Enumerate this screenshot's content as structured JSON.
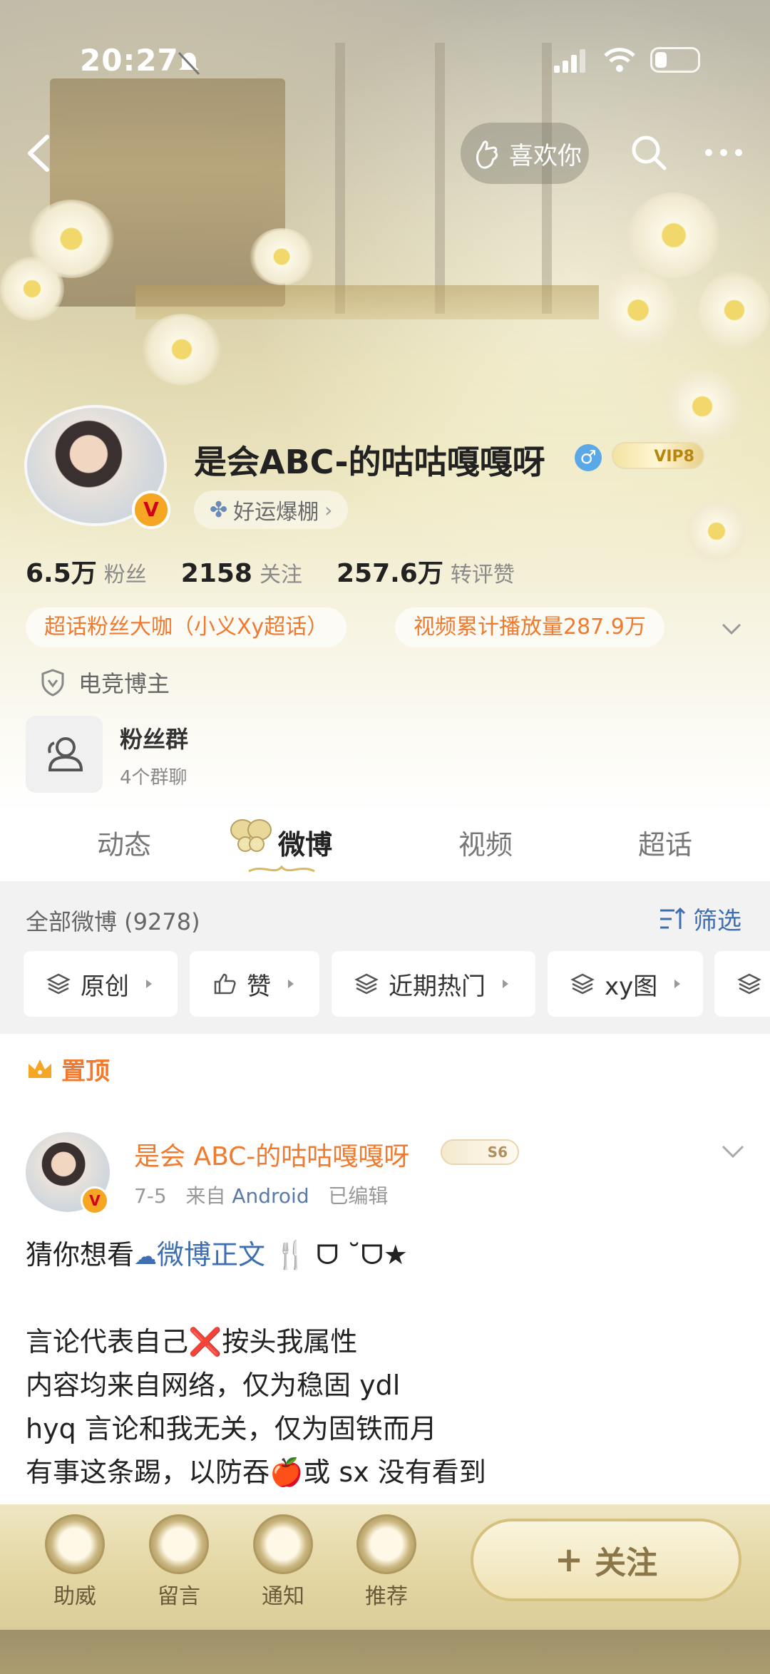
{
  "status_bar": {
    "time": "20:27"
  },
  "nav": {
    "like_label": "喜欢你"
  },
  "profile": {
    "name": "是会ABC-的咕咕嘎嘎呀",
    "vip_label": "VIP8",
    "luck_label": "好运爆棚",
    "verified_mark": "V",
    "stats": [
      {
        "num": "6.5万",
        "label": "粉丝"
      },
      {
        "num": "2158",
        "label": "关注"
      },
      {
        "num": "257.6万",
        "label": "转评赞"
      }
    ],
    "tags": [
      "超话粉丝大咖（小义Xy超话）",
      "视频累计播放量287.9万"
    ],
    "role": "电竞博主",
    "group": {
      "title": "粉丝群",
      "subtitle": "4个群聊"
    }
  },
  "tabs": [
    "动态",
    "微博",
    "视频",
    "超话"
  ],
  "feed": {
    "all_count": "全部微博 (9278)",
    "filter_label": "筛选",
    "chips": [
      "原创",
      "赞",
      "近期热门",
      "xy图"
    ]
  },
  "post": {
    "pinned_label": "置顶",
    "author": "是会 ABC-的咕咕嘎嘎呀",
    "level": "S6",
    "date": "7-5",
    "source_prefix": "来自",
    "source": "Android",
    "edited": "已编辑",
    "lines": [
      {
        "pre": "猜你想看",
        "link": "微博正文",
        "post": " ᗜ ˘ᗜ★"
      },
      {
        "text": ""
      },
      {
        "pre": "言论代表自己",
        "mark": "❌",
        "post": "按头我属性"
      },
      {
        "text": "内容均来自网络，仅为稳固 ydl"
      },
      {
        "text": "hyq 言论和我无关，仅为固铁而月"
      },
      {
        "pre": "有事这条踢，以防吞",
        "apple": "🍎",
        "post": "或 sx 没有看到"
      }
    ]
  },
  "bottom_bar": {
    "items": [
      "助威",
      "留言",
      "通知",
      "推荐"
    ],
    "follow_label": "关注"
  },
  "colors": {
    "accent_orange": "#f07a2e",
    "link_blue": "#3f6fb0"
  }
}
